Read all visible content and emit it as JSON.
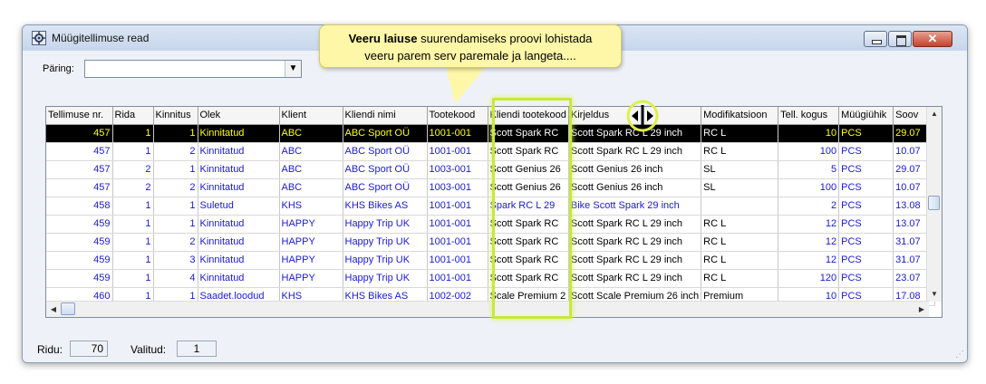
{
  "window": {
    "title": "Müügitellimuse read",
    "app_icon": "gear-window-icon"
  },
  "query": {
    "label": "Päring:",
    "value": ""
  },
  "tooltip": {
    "bold": "Veeru laiuse",
    "line1_rest": " suurendamiseks proovi lohistada",
    "line2": "veeru parem serv paremale ja langeta...."
  },
  "table": {
    "columns": [
      "Tellimuse nr.",
      "Rida",
      "Kinnitus",
      "Olek",
      "Klient",
      "Kliendi nimi",
      "Tootekood",
      "Kliendi tootekood",
      "Kirjeldus",
      "Modifikatsioon",
      "Tell. kogus",
      "Müügiühik",
      "Soov"
    ],
    "rows": [
      [
        "457",
        "1",
        "1",
        "Kinnitatud",
        "ABC",
        "ABC Sport OÜ",
        "1001-001",
        "Scott Spark RC",
        "Scott Spark RC L 29 inch",
        "RC L",
        "10",
        "PCS",
        "29.07"
      ],
      [
        "457",
        "1",
        "2",
        "Kinnitatud",
        "ABC",
        "ABC Sport OÜ",
        "1001-001",
        "Scott Spark RC",
        "Scott Spark RC L 29 inch",
        "RC L",
        "100",
        "PCS",
        "10.07"
      ],
      [
        "457",
        "2",
        "1",
        "Kinnitatud",
        "ABC",
        "ABC Sport OÜ",
        "1003-001",
        "Scott Genius 26",
        "Scott Genius 26 inch",
        "SL",
        "5",
        "PCS",
        "29.07"
      ],
      [
        "457",
        "2",
        "2",
        "Kinnitatud",
        "ABC",
        "ABC Sport OÜ",
        "1003-001",
        "Scott Genius 26",
        "Scott Genius 26 inch",
        "SL",
        "100",
        "PCS",
        "10.07"
      ],
      [
        "458",
        "1",
        "1",
        "Suletud",
        "KHS",
        "KHS Bikes AS",
        "1001-001",
        "Spark RC L 29",
        "Bike Scott Spark 29 inch",
        "",
        "2",
        "PCS",
        "13.08"
      ],
      [
        "459",
        "1",
        "1",
        "Kinnitatud",
        "HAPPY",
        "Happy Trip UK",
        "1001-001",
        "Scott Spark RC",
        "Scott Spark RC L 29 inch",
        "RC L",
        "12",
        "PCS",
        "13.07"
      ],
      [
        "459",
        "1",
        "2",
        "Kinnitatud",
        "HAPPY",
        "Happy Trip UK",
        "1001-001",
        "Scott Spark RC",
        "Scott Spark RC L 29 inch",
        "RC L",
        "12",
        "PCS",
        "31.07"
      ],
      [
        "459",
        "1",
        "3",
        "Kinnitatud",
        "HAPPY",
        "Happy Trip UK",
        "1001-001",
        "Scott Spark RC",
        "Scott Spark RC L 29 inch",
        "RC L",
        "12",
        "PCS",
        "31.07"
      ],
      [
        "459",
        "1",
        "4",
        "Kinnitatud",
        "HAPPY",
        "Happy Trip UK",
        "1001-001",
        "Scott Spark RC",
        "Scott Spark RC L 29 inch",
        "RC L",
        "120",
        "PCS",
        "23.07"
      ],
      [
        "460",
        "1",
        "1",
        "Saadet.loodud",
        "KHS",
        "KHS Bikes AS",
        "1002-002",
        "Scale Premium 2",
        "Scott Scale Premium 26 inch",
        "Premium",
        "10",
        "PCS",
        "17.08"
      ]
    ],
    "selected_row": 0
  },
  "status": {
    "rows_label": "Ridu:",
    "rows_value": "70",
    "selected_label": "Valitud:",
    "selected_value": "1"
  },
  "colors": {
    "link": "#1a1ad0",
    "selected_bg": "#000000",
    "selected_text": "#ffff00",
    "highlight": "#c8e83a",
    "tooltip_bg": "#fef7a8"
  }
}
